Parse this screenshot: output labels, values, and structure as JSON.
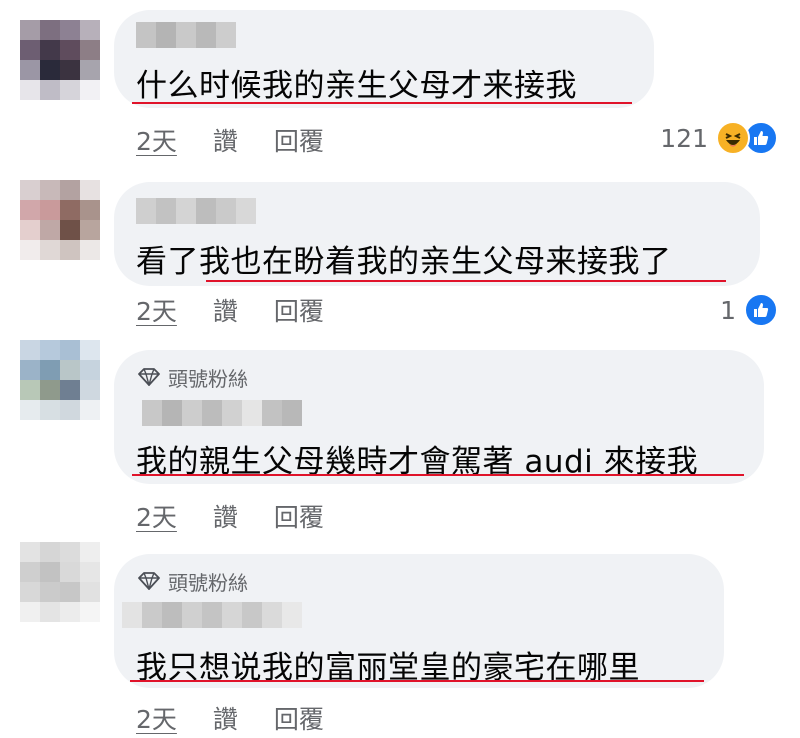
{
  "comments": [
    {
      "text": "什么时候我的亲生父母才来接我",
      "time": "2天",
      "like_label": "讚",
      "reply_label": "回覆",
      "reaction_count": "121",
      "reactions": [
        "haha-icon",
        "like-icon"
      ]
    },
    {
      "text": "看了我也在盼着我的亲生父母来接我了",
      "time": "2天",
      "like_label": "讚",
      "reply_label": "回覆",
      "reaction_count": "1",
      "reactions": [
        "like-icon"
      ]
    },
    {
      "badge": "頭號粉絲",
      "text": "我的親生父母幾時才會駕著 audi 來接我",
      "time": "2天",
      "like_label": "讚",
      "reply_label": "回覆"
    },
    {
      "badge": "頭號粉絲",
      "text": "我只想说我的富丽堂皇的豪宅在哪里",
      "time": "2天",
      "like_label": "讚",
      "reply_label": "回覆"
    }
  ],
  "colors": {
    "bubble": "#f0f2f5",
    "underline": "#e0132a",
    "meta_text": "#65676b",
    "like_blue": "#1877f2",
    "haha_yellow": "#f7b125"
  }
}
